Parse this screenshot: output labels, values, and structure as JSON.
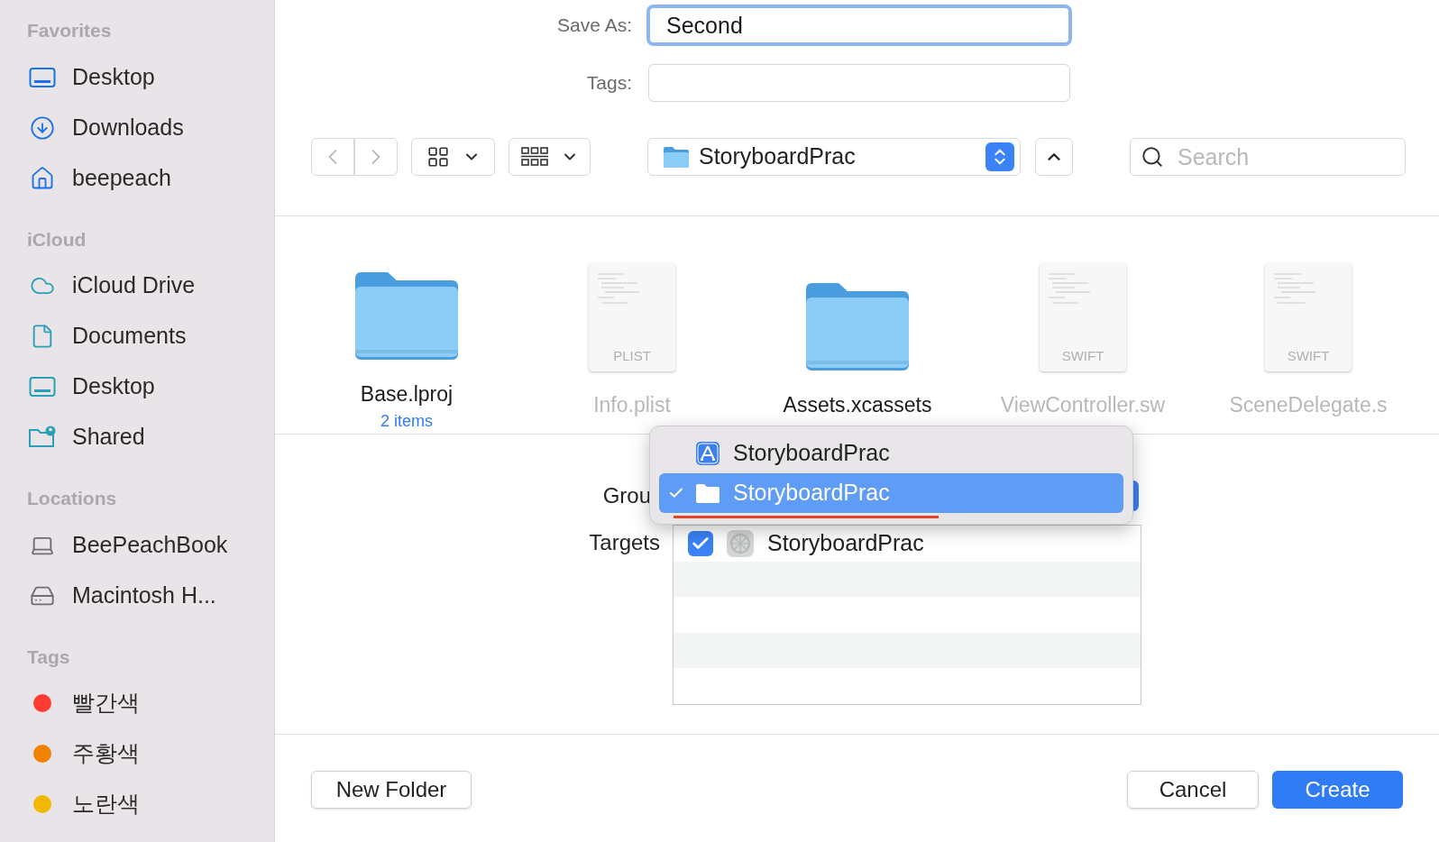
{
  "sidebar": {
    "sections": [
      {
        "kind": "favorites",
        "heading": "Favorites",
        "items": [
          {
            "kind": "desktop",
            "label": "Desktop"
          },
          {
            "kind": "downloads",
            "label": "Downloads"
          },
          {
            "kind": "home",
            "label": "beepeach"
          }
        ]
      },
      {
        "kind": "icloud",
        "heading": "iCloud",
        "items": [
          {
            "kind": "cloud",
            "label": "iCloud Drive"
          },
          {
            "kind": "document",
            "label": "Documents"
          },
          {
            "kind": "desktop",
            "label": "Desktop"
          },
          {
            "kind": "shared",
            "label": "Shared"
          }
        ]
      },
      {
        "kind": "locations",
        "heading": "Locations",
        "items": [
          {
            "kind": "laptop",
            "label": "BeePeachBook"
          },
          {
            "kind": "disk",
            "label": "Macintosh H..."
          }
        ]
      },
      {
        "kind": "tags",
        "heading": "Tags",
        "items": [
          {
            "kind": "tag",
            "label": "빨간색",
            "color": "#ff3b30"
          },
          {
            "kind": "tag",
            "label": "주황색",
            "color": "#f08200"
          },
          {
            "kind": "tag",
            "label": "노란색",
            "color": "#f0b800"
          }
        ]
      }
    ]
  },
  "save_as": {
    "label": "Save As:",
    "value": "Second"
  },
  "tags_field": {
    "label": "Tags:"
  },
  "toolbar": {
    "location": "StoryboardPrac",
    "search": {
      "placeholder": "Search"
    }
  },
  "files": [
    {
      "kind": "folder",
      "name": "Base.lproj",
      "subtitle": "2 items",
      "disabled": false
    },
    {
      "kind": "document",
      "name": "Info.plist",
      "badge": "PLIST",
      "disabled": true
    },
    {
      "kind": "folder",
      "name": "Assets.xcassets",
      "disabled": false
    },
    {
      "kind": "document",
      "name": "ViewController.sw",
      "badge": "SWIFT",
      "disabled": true
    },
    {
      "kind": "document",
      "name": "SceneDelegate.s",
      "badge": "SWIFT",
      "disabled": true
    }
  ],
  "group": {
    "label": "Grou"
  },
  "targets": {
    "label": "Targets",
    "items": [
      {
        "name": "StoryboardPrac",
        "checked": true
      }
    ]
  },
  "group_menu": {
    "items": [
      {
        "kind": "project",
        "label": "StoryboardPrac",
        "selected": false
      },
      {
        "kind": "folder",
        "label": "StoryboardPrac",
        "selected": true
      }
    ]
  },
  "buttons": {
    "new_folder": "New Folder",
    "cancel": "Cancel",
    "create": "Create"
  }
}
